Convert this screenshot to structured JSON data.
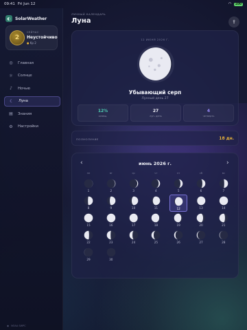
{
  "status": {
    "time": "09:41",
    "date": "Fri Jun 12",
    "battery": "100"
  },
  "app": {
    "name": "SolarWeather"
  },
  "now": {
    "label": "СЕЙЧАС",
    "kp_value": "2",
    "title": "Неустойчиво",
    "kp_text": "Kp 2"
  },
  "nav": {
    "items": [
      {
        "label": "Главная",
        "icon": "home-icon",
        "glyph": "◎"
      },
      {
        "label": "Солнце",
        "icon": "sun-icon",
        "glyph": "☼"
      },
      {
        "label": "Ночью",
        "icon": "bell-icon",
        "glyph": "♪"
      },
      {
        "label": "Луна",
        "icon": "moon-icon",
        "glyph": "☾",
        "active": true
      },
      {
        "label": "Знания",
        "icon": "book-icon",
        "glyph": "▤"
      },
      {
        "label": "Настройки",
        "icon": "gear-icon",
        "glyph": "⚙"
      }
    ]
  },
  "footer": {
    "text": "NOAA SWPC"
  },
  "page": {
    "caption": "ЛУННЫЙ КАЛЕНДАРЬ",
    "title": "Луна"
  },
  "hero": {
    "date": "12 ИЮНЯ 2026 Г.",
    "phase_name": "Убывающий серп",
    "lunar_day": "Лунный день 27",
    "illumination": 0.12,
    "waning": true,
    "stats": [
      {
        "value": "12%",
        "label": "освещ.",
        "color": "#4fd1b5"
      },
      {
        "value": "27",
        "label": "лун. день",
        "color": "#f1f2f8"
      },
      {
        "value": "4",
        "label": "четверть",
        "color": "#9b8cff"
      }
    ]
  },
  "full_moon": {
    "label": "ПОЛНОЛУНИЕ",
    "value": "18 дн."
  },
  "calendar": {
    "month": "июнь 2026 г.",
    "weekdays": [
      "пн",
      "вт",
      "ср",
      "чт",
      "пт",
      "сб",
      "вс"
    ],
    "start_offset": 0,
    "days": [
      {
        "n": "1",
        "phase": 0.53
      },
      {
        "n": "2",
        "phase": 0.57
      },
      {
        "n": "3",
        "phase": 0.6
      },
      {
        "n": "4",
        "phase": 0.63
      },
      {
        "n": "5",
        "phase": 0.67
      },
      {
        "n": "6",
        "phase": 0.7
      },
      {
        "n": "7",
        "phase": 0.73
      },
      {
        "n": "8",
        "phase": 0.77
      },
      {
        "n": "9",
        "phase": 0.8
      },
      {
        "n": "10",
        "phase": 0.83
      },
      {
        "n": "11",
        "phase": 0.87
      },
      {
        "n": "12",
        "phase": 0.9,
        "selected": true
      },
      {
        "n": "13",
        "phase": 0.93
      },
      {
        "n": "14",
        "phase": 0.97
      },
      {
        "n": "15",
        "phase": 0.0
      },
      {
        "n": "16",
        "phase": 0.03
      },
      {
        "n": "17",
        "phase": 0.07
      },
      {
        "n": "18",
        "phase": 0.1
      },
      {
        "n": "19",
        "phase": 0.13
      },
      {
        "n": "20",
        "phase": 0.17
      },
      {
        "n": "21",
        "phase": 0.2
      },
      {
        "n": "22",
        "phase": 0.23
      },
      {
        "n": "23",
        "phase": 0.27
      },
      {
        "n": "24",
        "phase": 0.3
      },
      {
        "n": "25",
        "phase": 0.33
      },
      {
        "n": "26",
        "phase": 0.37
      },
      {
        "n": "27",
        "phase": 0.4
      },
      {
        "n": "28",
        "phase": 0.43
      },
      {
        "n": "29",
        "phase": 0.47
      },
      {
        "n": "30",
        "phase": 0.5
      }
    ]
  }
}
